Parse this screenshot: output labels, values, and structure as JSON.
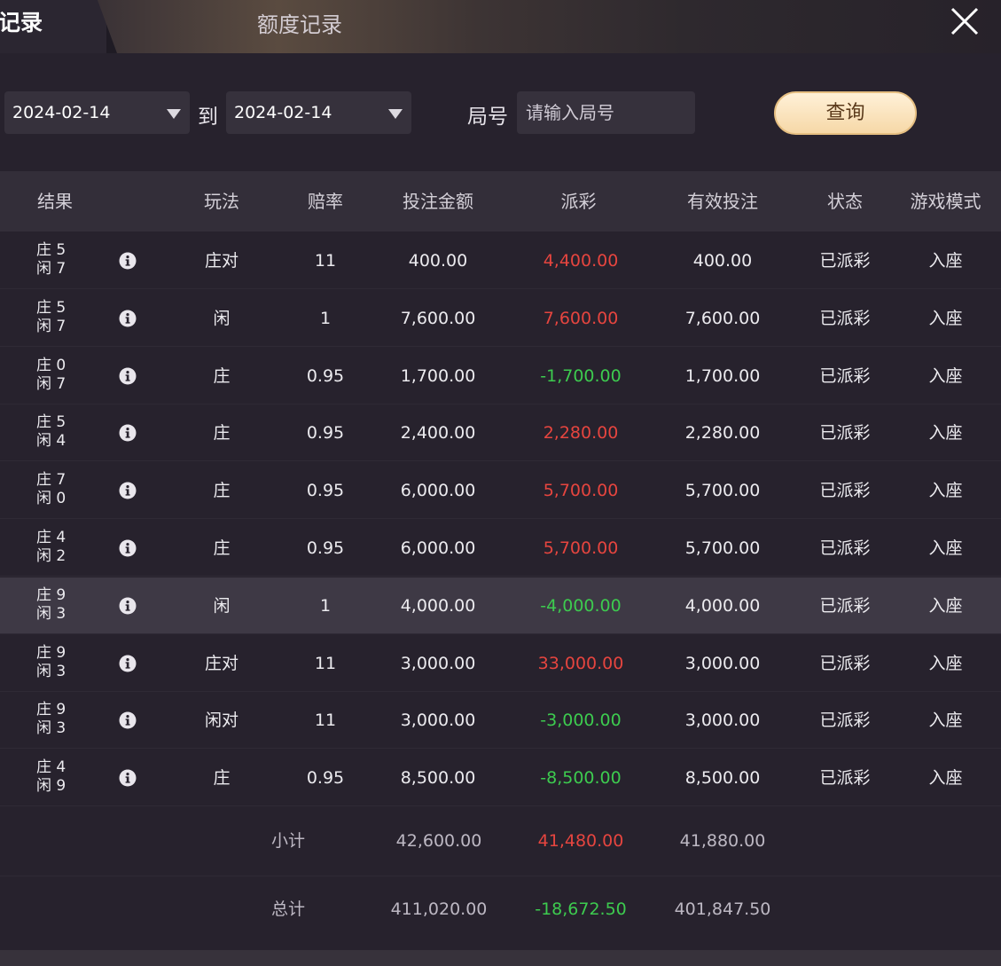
{
  "header": {
    "active_tab_label": "记录",
    "tab_title": "额度记录",
    "close_icon": "close-icon"
  },
  "filters": {
    "start_date": "2024-02-14",
    "to_label": "到",
    "end_date": "2024-02-14",
    "round_label": "局号",
    "round_placeholder": "请输入局号",
    "query_label": "查询"
  },
  "table": {
    "columns": [
      "结果",
      "玩法",
      "赔率",
      "投注金额",
      "派彩",
      "有效投注",
      "状态",
      "游戏模式"
    ],
    "rows": [
      {
        "banker": "庄 5",
        "player": "闲 7",
        "bet_type": "庄对",
        "odds": "11",
        "amount": "400.00",
        "payout": "4,400.00",
        "payout_color": "red",
        "valid": "400.00",
        "status": "已派彩",
        "mode": "入座"
      },
      {
        "banker": "庄 5",
        "player": "闲 7",
        "bet_type": "闲",
        "odds": "1",
        "amount": "7,600.00",
        "payout": "7,600.00",
        "payout_color": "red",
        "valid": "7,600.00",
        "status": "已派彩",
        "mode": "入座"
      },
      {
        "banker": "庄 0",
        "player": "闲 7",
        "bet_type": "庄",
        "odds": "0.95",
        "amount": "1,700.00",
        "payout": "-1,700.00",
        "payout_color": "green",
        "valid": "1,700.00",
        "status": "已派彩",
        "mode": "入座"
      },
      {
        "banker": "庄 5",
        "player": "闲 4",
        "bet_type": "庄",
        "odds": "0.95",
        "amount": "2,400.00",
        "payout": "2,280.00",
        "payout_color": "red",
        "valid": "2,280.00",
        "status": "已派彩",
        "mode": "入座"
      },
      {
        "banker": "庄 7",
        "player": "闲 0",
        "bet_type": "庄",
        "odds": "0.95",
        "amount": "6,000.00",
        "payout": "5,700.00",
        "payout_color": "red",
        "valid": "5,700.00",
        "status": "已派彩",
        "mode": "入座"
      },
      {
        "banker": "庄 4",
        "player": "闲 2",
        "bet_type": "庄",
        "odds": "0.95",
        "amount": "6,000.00",
        "payout": "5,700.00",
        "payout_color": "red",
        "valid": "5,700.00",
        "status": "已派彩",
        "mode": "入座"
      },
      {
        "banker": "庄 9",
        "player": "闲 3",
        "bet_type": "闲",
        "odds": "1",
        "amount": "4,000.00",
        "payout": "-4,000.00",
        "payout_color": "green",
        "valid": "4,000.00",
        "status": "已派彩",
        "mode": "入座",
        "highlight": true
      },
      {
        "banker": "庄 9",
        "player": "闲 3",
        "bet_type": "庄对",
        "odds": "11",
        "amount": "3,000.00",
        "payout": "33,000.00",
        "payout_color": "red",
        "valid": "3,000.00",
        "status": "已派彩",
        "mode": "入座"
      },
      {
        "banker": "庄 9",
        "player": "闲 3",
        "bet_type": "闲对",
        "odds": "11",
        "amount": "3,000.00",
        "payout": "-3,000.00",
        "payout_color": "green",
        "valid": "3,000.00",
        "status": "已派彩",
        "mode": "入座"
      },
      {
        "banker": "庄 4",
        "player": "闲 9",
        "bet_type": "庄",
        "odds": "0.95",
        "amount": "8,500.00",
        "payout": "-8,500.00",
        "payout_color": "green",
        "valid": "8,500.00",
        "status": "已派彩",
        "mode": "入座"
      }
    ]
  },
  "subtotal": {
    "label": "小计",
    "amount": "42,600.00",
    "payout": "41,480.00",
    "payout_color": "red",
    "valid": "41,880.00"
  },
  "total": {
    "label": "总计",
    "amount": "411,020.00",
    "payout": "-18,672.50",
    "payout_color": "green",
    "valid": "401,847.50"
  },
  "colors": {
    "red": "#e6453f",
    "green": "#3dcb4f",
    "accent": "#f6d8a7"
  }
}
